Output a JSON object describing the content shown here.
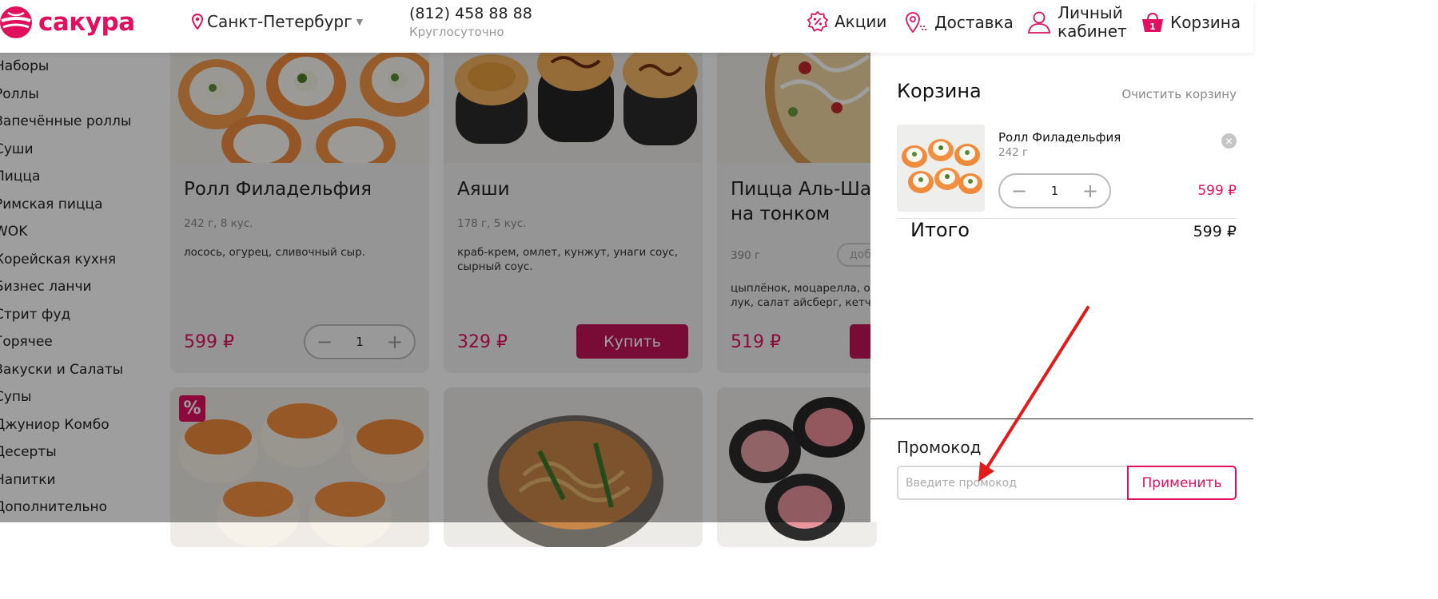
{
  "header": {
    "logo_text": "сакура",
    "city": "Санкт-Петербург",
    "phone": "(812) 458 88 88",
    "phone_note": "Круглосуточно",
    "nav": {
      "promo": "Акции",
      "delivery": "Доставка",
      "account": "Личный кабинет",
      "cart": "Корзина",
      "cart_count": "1"
    }
  },
  "categories": [
    "Наборы",
    "Роллы",
    "Запечённые роллы",
    "Суши",
    "Пицца",
    "Римская пицца",
    "WOK",
    "Корейская кухня",
    "Бизнес ланчи",
    "Стрит фуд",
    "Горячее",
    "Закуски и Салаты",
    "Супы",
    "Джуниор Комбо",
    "Десерты",
    "Напитки",
    "Дополнительно"
  ],
  "products": [
    {
      "title": "Ролл Филадельфия",
      "meta": "242 г, 8 кус.",
      "desc": "лосось, огурец, сливочный сыр.",
      "price": "599 ₽",
      "qty": "1"
    },
    {
      "title": "Аяши",
      "meta": "178 г, 5 кус.",
      "desc": "краб-крем, омлет, кунжут, унаги соус, сырный соус.",
      "price": "329 ₽",
      "buy_label": "Купить"
    },
    {
      "title": "Пицца Аль-Ша на тонком",
      "meta": "390 г",
      "add_label": "доба",
      "desc": "цыплёнок, моцарелла, огу лук, салат айсберг, кетчуп",
      "price": "519 ₽"
    }
  ],
  "badges": {
    "discount": "%"
  },
  "cart": {
    "title": "Корзина",
    "clear_label": "Очистить корзину",
    "item": {
      "name": "Ролл Филадельфия",
      "weight": "242 г",
      "qty": "1",
      "price": "599 ₽"
    },
    "total_label": "Итого",
    "total_value": "599 ₽",
    "promo_label": "Промокод",
    "promo_placeholder": "Введите промокод",
    "promo_value": "",
    "apply_label": "Применить"
  },
  "colors": {
    "brand": "#e0105f",
    "buy_button": "#c4145a",
    "annotation_arrow": "#e21b1b"
  }
}
